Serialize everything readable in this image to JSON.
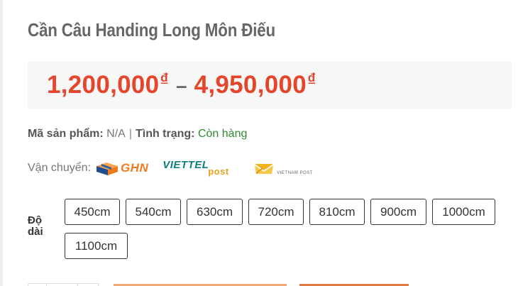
{
  "product": {
    "title": "Cần Câu Handing Long Môn Điếu"
  },
  "price": {
    "min_amount": "1,200,000",
    "max_amount": "4,950,000",
    "currency_symbol": "₫",
    "separator": "–",
    "color": "#e5452b"
  },
  "meta": {
    "sku_label": "Mã sản phẩm:",
    "sku_value": "N/A",
    "divider": "|",
    "status_label": "Tình trạng:",
    "status_value": "Còn hàng",
    "status_color": "#2e8a2e"
  },
  "shipping": {
    "label": "Vận chuyển:",
    "carriers": [
      {
        "name": "ghn-logo",
        "text": "GHN"
      },
      {
        "name": "viettel-post-logo",
        "text_top": "VIETTEL",
        "text_bottom": "post"
      },
      {
        "name": "vietnam-post-logo",
        "text": "VIETNAM POST"
      }
    ]
  },
  "attributes": {
    "length": {
      "label": "Độ dài",
      "options": [
        "450cm",
        "540cm",
        "630cm",
        "720cm",
        "810cm",
        "900cm",
        "1000cm",
        "1100cm"
      ]
    }
  }
}
